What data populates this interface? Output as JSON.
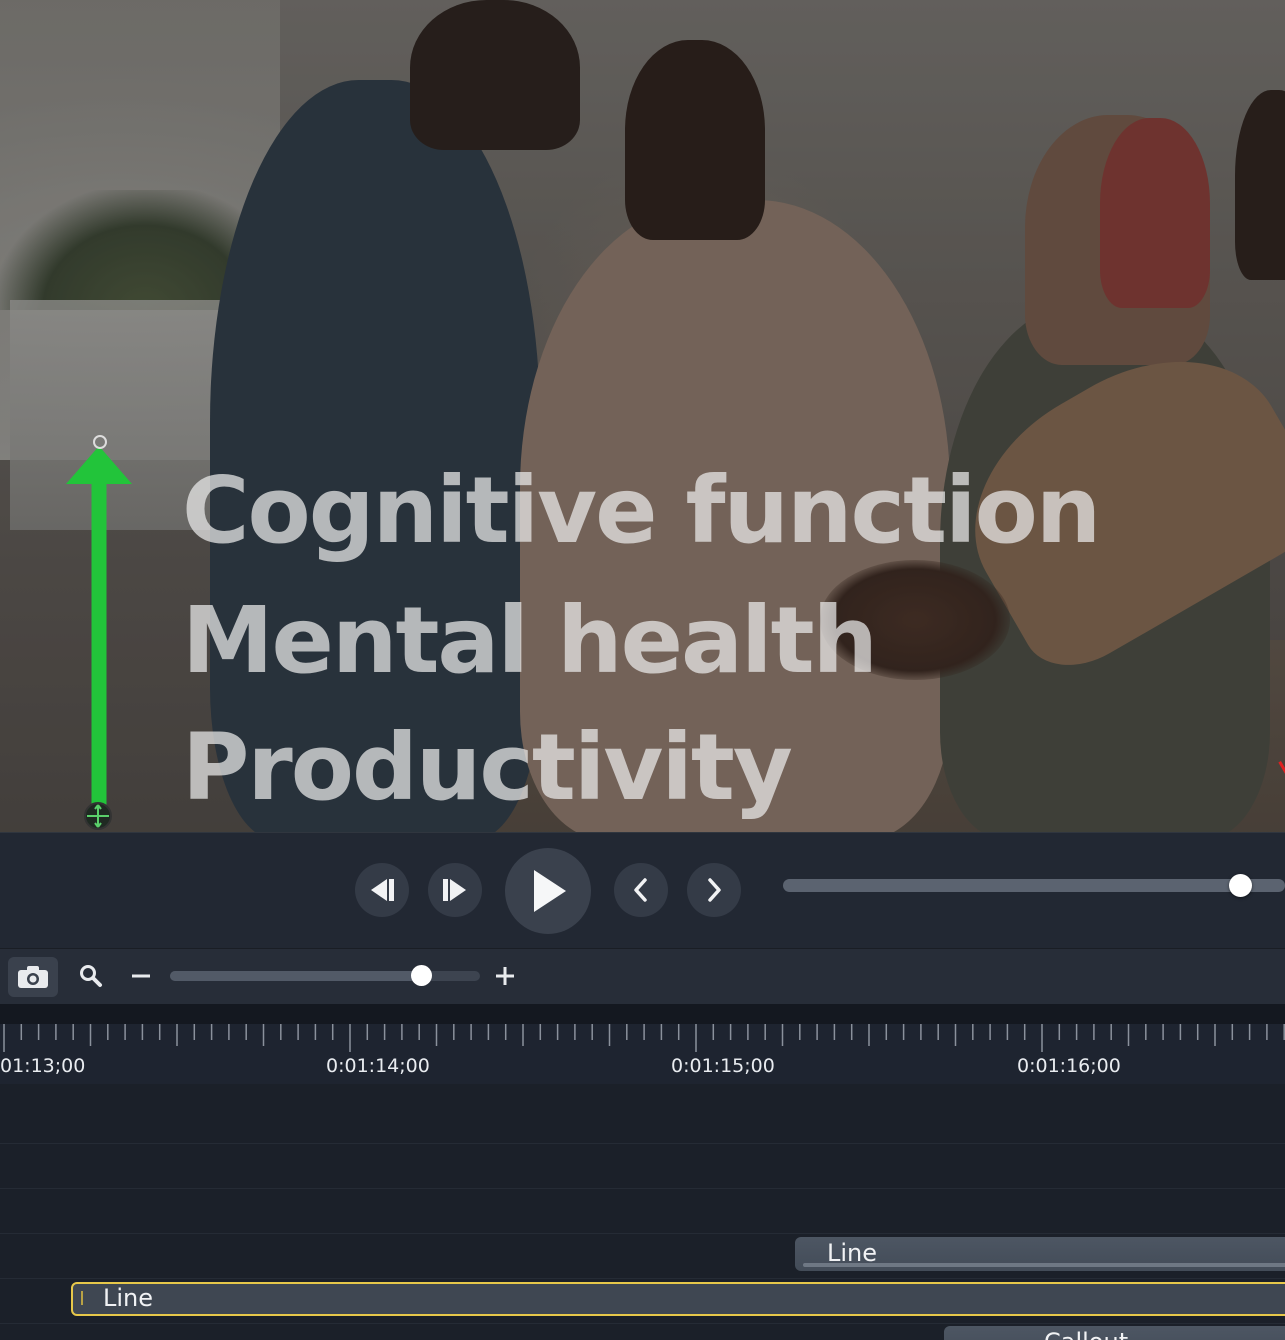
{
  "canvas": {
    "overlay_lines": [
      "Cognitive function",
      "Mental health",
      "Productivity"
    ],
    "arrow_color": "#22c43a"
  },
  "playback": {
    "buttons": [
      "step-back",
      "step-forward",
      "play",
      "previous",
      "next"
    ],
    "scrub_position": 0.91
  },
  "timeline_toolbar": {
    "zoom_level": 0.81
  },
  "ruler": {
    "labels": [
      "01:13;00",
      "0:01:14;00",
      "0:01:15;00",
      "0:01:16;00"
    ]
  },
  "tracks": {
    "clips": [
      {
        "label": "Line",
        "selected": false
      },
      {
        "label": "Line",
        "selected": true
      },
      {
        "label": "Callout",
        "selected": false
      }
    ],
    "selected_color": "#e7c84a"
  }
}
